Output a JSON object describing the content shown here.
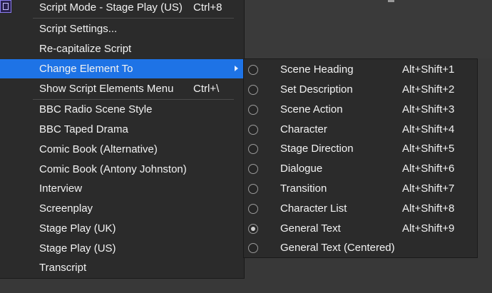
{
  "main_menu": {
    "items": [
      {
        "label": "Script Mode - Stage Play (US)",
        "shortcut": "Ctrl+8",
        "icon": "script-mode-icon"
      },
      {
        "label": "Script Settings...",
        "shortcut": ""
      },
      {
        "label": "Re-capitalize Script",
        "shortcut": ""
      },
      {
        "label": "Change Element To",
        "shortcut": "",
        "has_submenu": true,
        "highlighted": true
      },
      {
        "label": "Show Script Elements Menu",
        "shortcut": "Ctrl+\\"
      },
      {
        "label": "BBC Radio Scene Style",
        "shortcut": ""
      },
      {
        "label": "BBC Taped Drama",
        "shortcut": ""
      },
      {
        "label": "Comic Book (Alternative)",
        "shortcut": ""
      },
      {
        "label": "Comic Book (Antony Johnston)",
        "shortcut": ""
      },
      {
        "label": "Interview",
        "shortcut": ""
      },
      {
        "label": "Screenplay",
        "shortcut": ""
      },
      {
        "label": "Stage Play (UK)",
        "shortcut": ""
      },
      {
        "label": "Stage Play (US)",
        "shortcut": ""
      },
      {
        "label": "Transcript",
        "shortcut": ""
      }
    ]
  },
  "submenu": {
    "items": [
      {
        "label": "Scene Heading",
        "shortcut": "Alt+Shift+1",
        "checked": false
      },
      {
        "label": "Set Description",
        "shortcut": "Alt+Shift+2",
        "checked": false
      },
      {
        "label": "Scene Action",
        "shortcut": "Alt+Shift+3",
        "checked": false
      },
      {
        "label": "Character",
        "shortcut": "Alt+Shift+4",
        "checked": false
      },
      {
        "label": "Stage Direction",
        "shortcut": "Alt+Shift+5",
        "checked": false
      },
      {
        "label": "Dialogue",
        "shortcut": "Alt+Shift+6",
        "checked": false
      },
      {
        "label": "Transition",
        "shortcut": "Alt+Shift+7",
        "checked": false
      },
      {
        "label": "Character List",
        "shortcut": "Alt+Shift+8",
        "checked": false
      },
      {
        "label": "General Text",
        "shortcut": "Alt+Shift+9",
        "checked": true
      },
      {
        "label": "General Text (Centered)",
        "shortcut": "",
        "checked": false
      }
    ]
  },
  "colors": {
    "menu_bg": "#2b2b2b",
    "highlight": "#1e73e6",
    "text": "#f2f2f2",
    "desktop_bg": "#383838"
  }
}
